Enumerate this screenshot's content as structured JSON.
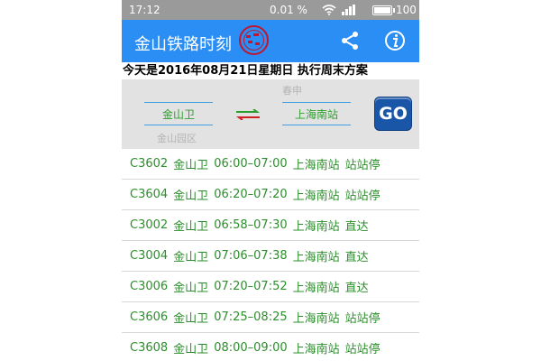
{
  "status_bar": {
    "time": "17:12",
    "rate": "0.01 %",
    "battery": "100",
    "battery_level": 1.0
  },
  "app_bar": {
    "title": "金山铁路时刻",
    "share_icon": "share-icon",
    "info_icon": "info-icon"
  },
  "date_line": "今天是2016年08月21日星期日   执行周末方案",
  "selector": {
    "from_station": "金山卫",
    "from_sub": "金山园区",
    "to_station": "上海南站",
    "to_sub": "春申",
    "go_label": "GO",
    "swap_icon": "swap-arrows-icon"
  },
  "colors": {
    "app_bar": "#2a8ef5",
    "status_bar": "#9a9a9a",
    "train_text": "#2c8e2c",
    "selector_bg": "#e2e2e2",
    "go_button": "#1a56a8"
  },
  "trains": [
    {
      "no": "C3602",
      "from": "金山卫",
      "time": "06:00–07:00",
      "to": "上海南站",
      "type": "站站停"
    },
    {
      "no": "C3604",
      "from": "金山卫",
      "time": "06:20–07:20",
      "to": "上海南站",
      "type": "站站停"
    },
    {
      "no": "C3002",
      "from": "金山卫",
      "time": "06:58–07:30",
      "to": "上海南站",
      "type": "直达"
    },
    {
      "no": "C3004",
      "from": "金山卫",
      "time": "07:06–07:38",
      "to": "上海南站",
      "type": "直达"
    },
    {
      "no": "C3006",
      "from": "金山卫",
      "time": "07:20–07:52",
      "to": "上海南站",
      "type": "直达"
    },
    {
      "no": "C3606",
      "from": "金山卫",
      "time": "07:25–08:25",
      "to": "上海南站",
      "type": "站站停"
    },
    {
      "no": "C3608",
      "from": "金山卫",
      "time": "08:00–09:00",
      "to": "上海南站",
      "type": "站站停"
    }
  ]
}
